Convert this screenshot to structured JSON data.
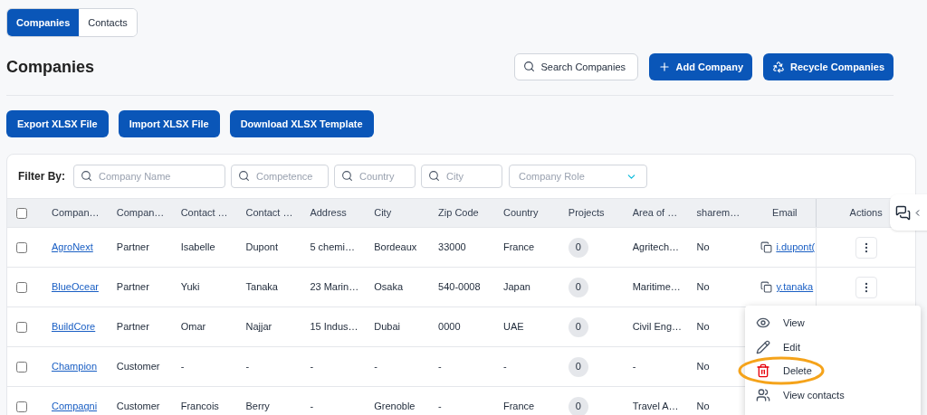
{
  "tabs": [
    {
      "label": "Companies",
      "selected": true
    },
    {
      "label": "Contacts",
      "selected": false
    }
  ],
  "title": "Companies",
  "search": {
    "placeholder": "Search Companies"
  },
  "header_buttons": [
    {
      "label": "Add Company",
      "kind": "add"
    },
    {
      "label": "Recycle Companies",
      "kind": "recycle"
    }
  ],
  "file_buttons": [
    "Export XLSX File",
    "Import XLSX File",
    "Download XLSX Template"
  ],
  "filter": {
    "label": "Filter By:",
    "fields": [
      {
        "placeholder": "Company Name",
        "kind": "search"
      },
      {
        "placeholder": "Competence",
        "kind": "search"
      },
      {
        "placeholder": "Country",
        "kind": "search"
      },
      {
        "placeholder": "City",
        "kind": "search"
      },
      {
        "placeholder": "Company Role",
        "kind": "select"
      }
    ]
  },
  "table": {
    "select_all": {
      "checked": false
    },
    "columns": [
      "Compan…",
      "Compan…",
      "Contact …",
      "Contact …",
      "Address",
      "City",
      "Zip Code",
      "Country",
      "Projects",
      "Area of …",
      "sharem…",
      "Email",
      "Actions"
    ],
    "rows": [
      {
        "checked": false,
        "cells": [
          "AgroNext",
          "Partner",
          "Isabelle",
          "Dupont",
          "5 chemi…",
          "Bordeaux",
          "33000",
          "France",
          "0",
          "Agritech…",
          "No"
        ],
        "email": "i.dupont("
      },
      {
        "checked": false,
        "cells": [
          "BlueOcear",
          "Partner",
          "Yuki",
          "Tanaka",
          "23 Marin…",
          "Osaka",
          "540-0008",
          "Japan",
          "0",
          "Maritime…",
          "No"
        ],
        "email": "y.tanaka"
      },
      {
        "checked": false,
        "cells": [
          "BuildCore",
          "Partner",
          "Omar",
          "Najjar",
          "15 Indus…",
          "Dubai",
          "0000",
          "UAE",
          "0",
          "Civil Eng…",
          "No"
        ]
      },
      {
        "checked": false,
        "cells": [
          "Champion",
          "Customer",
          "-",
          "-",
          "-",
          "-",
          "-",
          "-",
          "0",
          "-",
          "No"
        ]
      },
      {
        "checked": false,
        "cells": [
          "Compagni",
          "Customer",
          "Francois",
          "Berry",
          "-",
          "Grenoble",
          "-",
          "France",
          "0",
          "Travel A…",
          "No"
        ]
      }
    ]
  },
  "menu": [
    {
      "label": "View",
      "kind": "view",
      "highlighted": false
    },
    {
      "label": "Edit",
      "kind": "edit",
      "highlighted": false
    },
    {
      "label": "Delete",
      "kind": "delete",
      "highlighted": true
    },
    {
      "label": "View contacts",
      "kind": "contacts",
      "highlighted": false
    }
  ]
}
